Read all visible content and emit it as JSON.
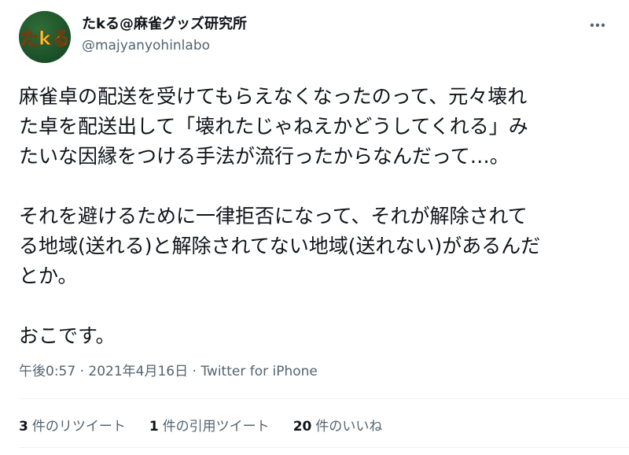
{
  "user": {
    "display_name": "たkる@麻雀グッズ研究所",
    "handle": "@majyanyohinlabo",
    "avatar_text": "たkる"
  },
  "tweet": {
    "lines": [
      "麻雀卓の配送を受けてもらえなくなったのって、元々壊れ",
      "た卓を配送出して「壊れたじゃねえかどうしてくれる」み",
      "たいな因縁をつける手法が流行ったからなんだって…。",
      "",
      "それを避けるために一律拒否になって、それが解除されて",
      "る地域(送れる)と解除されてない地域(送れない)があるんだ",
      "とか。",
      "",
      "おこです。"
    ]
  },
  "meta": {
    "time": "午後0:57",
    "separator": "·",
    "date": "2021年4月16日",
    "source": "Twitter for iPhone"
  },
  "stats": {
    "retweets": {
      "count": "3",
      "label": "件のリツイート"
    },
    "quotes": {
      "count": "1",
      "label": "件の引用ツイート"
    },
    "likes": {
      "count": "20",
      "label": "件のいいね"
    }
  },
  "icons": {
    "more": "more-horizontal-icon"
  },
  "colors": {
    "text": "#0f1419",
    "secondary": "#536471",
    "avatar_bg": "#1e5a2e",
    "avatar_text": "#f2c230"
  }
}
